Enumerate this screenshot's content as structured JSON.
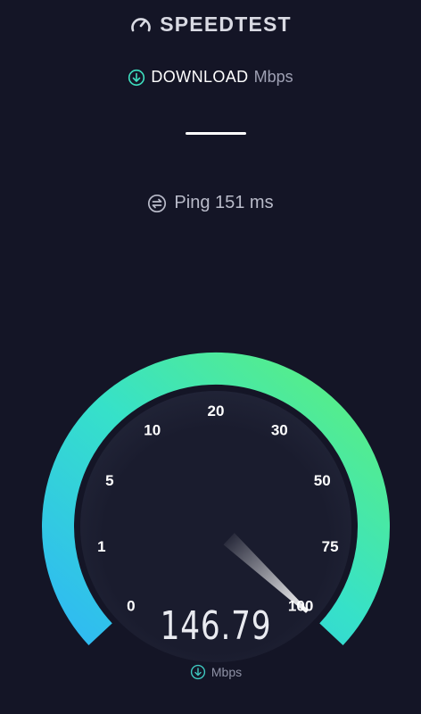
{
  "header": {
    "title": "SPEEDTEST",
    "logo_icon": "speedometer-logo-icon"
  },
  "test": {
    "mode_label": "DOWNLOAD",
    "mode_unit": "Mbps",
    "mode_icon": "download-arrow-icon",
    "result_placeholder": "—",
    "ping_label": "Ping 151 ms",
    "ping_icon": "ping-icon"
  },
  "gauge": {
    "ticks": [
      "0",
      "1",
      "5",
      "10",
      "20",
      "30",
      "50",
      "75",
      "100"
    ],
    "speed_value": "146.79",
    "speed_unit": "Mbps",
    "needle_reading": 100,
    "colors": {
      "arc_start": "#2fb9f3",
      "arc_mid": "#36e1c9",
      "arc_end": "#5ef07b",
      "background": "#141526"
    }
  }
}
